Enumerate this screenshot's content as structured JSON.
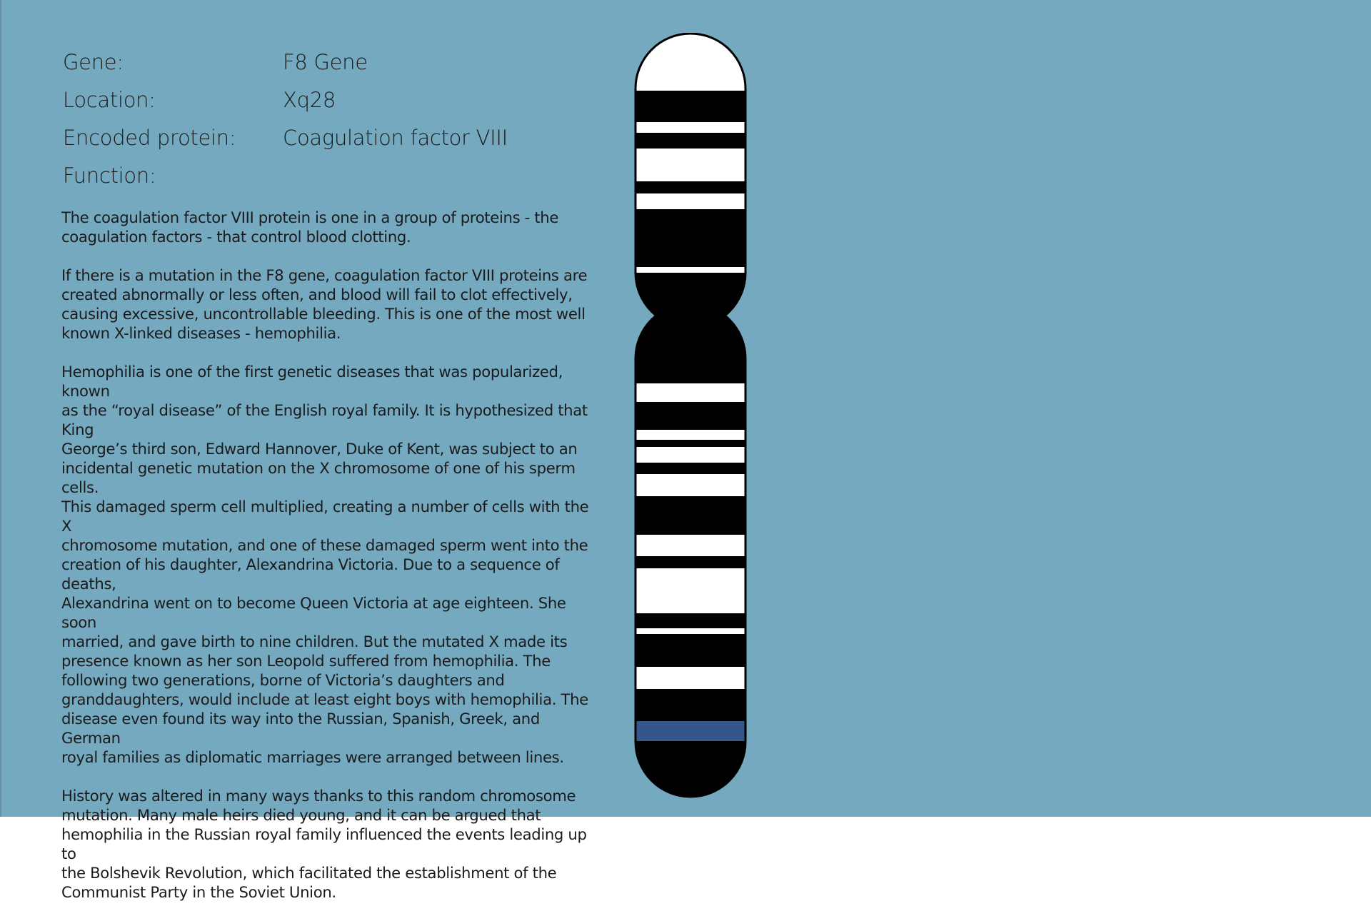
{
  "info": {
    "gene_label": "Gene:",
    "gene_value": "F8 Gene",
    "location_label": "Location:",
    "location_value": "Xq28",
    "protein_label": "Encoded protein:",
    "protein_value": "Coagulation factor VIII",
    "function_label": "Function:"
  },
  "paragraphs": [
    "The coagulation factor VIII protein is one in a group of proteins - the\ncoagulation factors - that control blood clotting.",
    "If there is a mutation in the F8 gene, coagulation factor VIII proteins are\ncreated abnormally or less often, and blood will fail to clot effectively,\ncausing excessive, uncontrollable bleeding. This is one of the most well\nknown X-linked diseases - hemophilia.",
    "Hemophilia is one of the first genetic diseases that was popularized, known\nas the “royal disease” of the English royal family. It is hypothesized that King\nGeorge’s third son, Edward Hannover, Duke of Kent, was subject to an\nincidental genetic mutation on the X chromosome of one of his sperm cells.\nThis damaged sperm cell multiplied, creating a number of cells with the X\nchromosome mutation, and one of these damaged sperm went into the\ncreation of his daughter, Alexandrina Victoria. Due to a sequence of deaths,\nAlexandrina went on to become Queen Victoria at age eighteen. She soon\nmarried, and gave birth to nine children. But the mutated X made its\npresence known as her son Leopold suffered from hemophilia. The\nfollowing two generations, borne of Victoria’s daughters and\ngranddaughters, would include at least eight boys with hemophilia. The\ndisease even found its way into the Russian, Spanish, Greek, and German\nroyal families as diplomatic marriages were arranged between lines.",
    "History was altered in many ways thanks to this random chromosome\nmutation. Many male heirs died young, and it can be argued that\nhemophilia in the Russian royal family influenced the events leading up to\nthe Bolshevik Revolution, which facilitated the establishment of the\nCommunist Party in the Soviet Union."
  ],
  "colors": {
    "background": "#74a9bf",
    "band_dark": "#000000",
    "band_light": "#ffffff",
    "highlight_band": "#35568a"
  }
}
